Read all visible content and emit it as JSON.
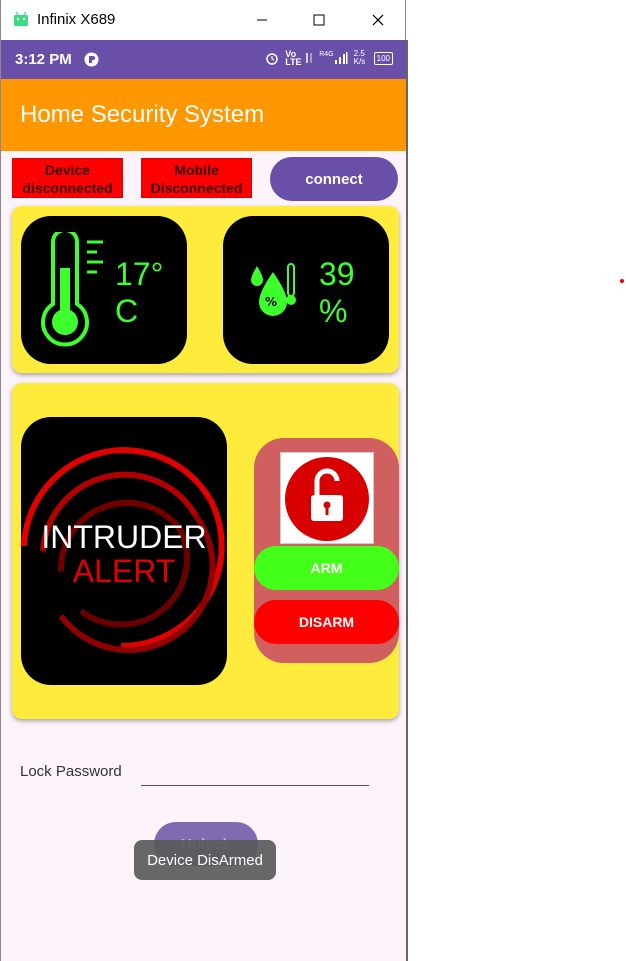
{
  "window": {
    "title": "Infinix X689"
  },
  "statusbar": {
    "time": "3:12 PM",
    "volte": "Vo LTE",
    "network": "R4G",
    "speed": "2.5 K/s",
    "battery": "100"
  },
  "appbar": {
    "title": "Home Security System"
  },
  "connection": {
    "device_status": "Device disconnected",
    "mobile_status": "Mobile Disconnected",
    "connect_label": "connect"
  },
  "sensors": {
    "temperature": {
      "value": "17°",
      "unit": "C"
    },
    "humidity": {
      "value": "39",
      "unit": "%"
    }
  },
  "alert": {
    "line1": "INTRUDER",
    "line2": "ALERT"
  },
  "controls": {
    "arm_label": "ARM",
    "disarm_label": "DISARM"
  },
  "password": {
    "label": "Lock Password",
    "value": "",
    "unlock_label": "Unlock"
  },
  "toast": {
    "message": "Device DisArmed"
  },
  "colors": {
    "accent": "#6a4fa8",
    "appbar": "#ff9800",
    "card": "#ffeb3b",
    "reading": "#3dff2e",
    "arm": "#44ff17",
    "disarm": "#ff0000",
    "lock_panel": "#d06060"
  }
}
